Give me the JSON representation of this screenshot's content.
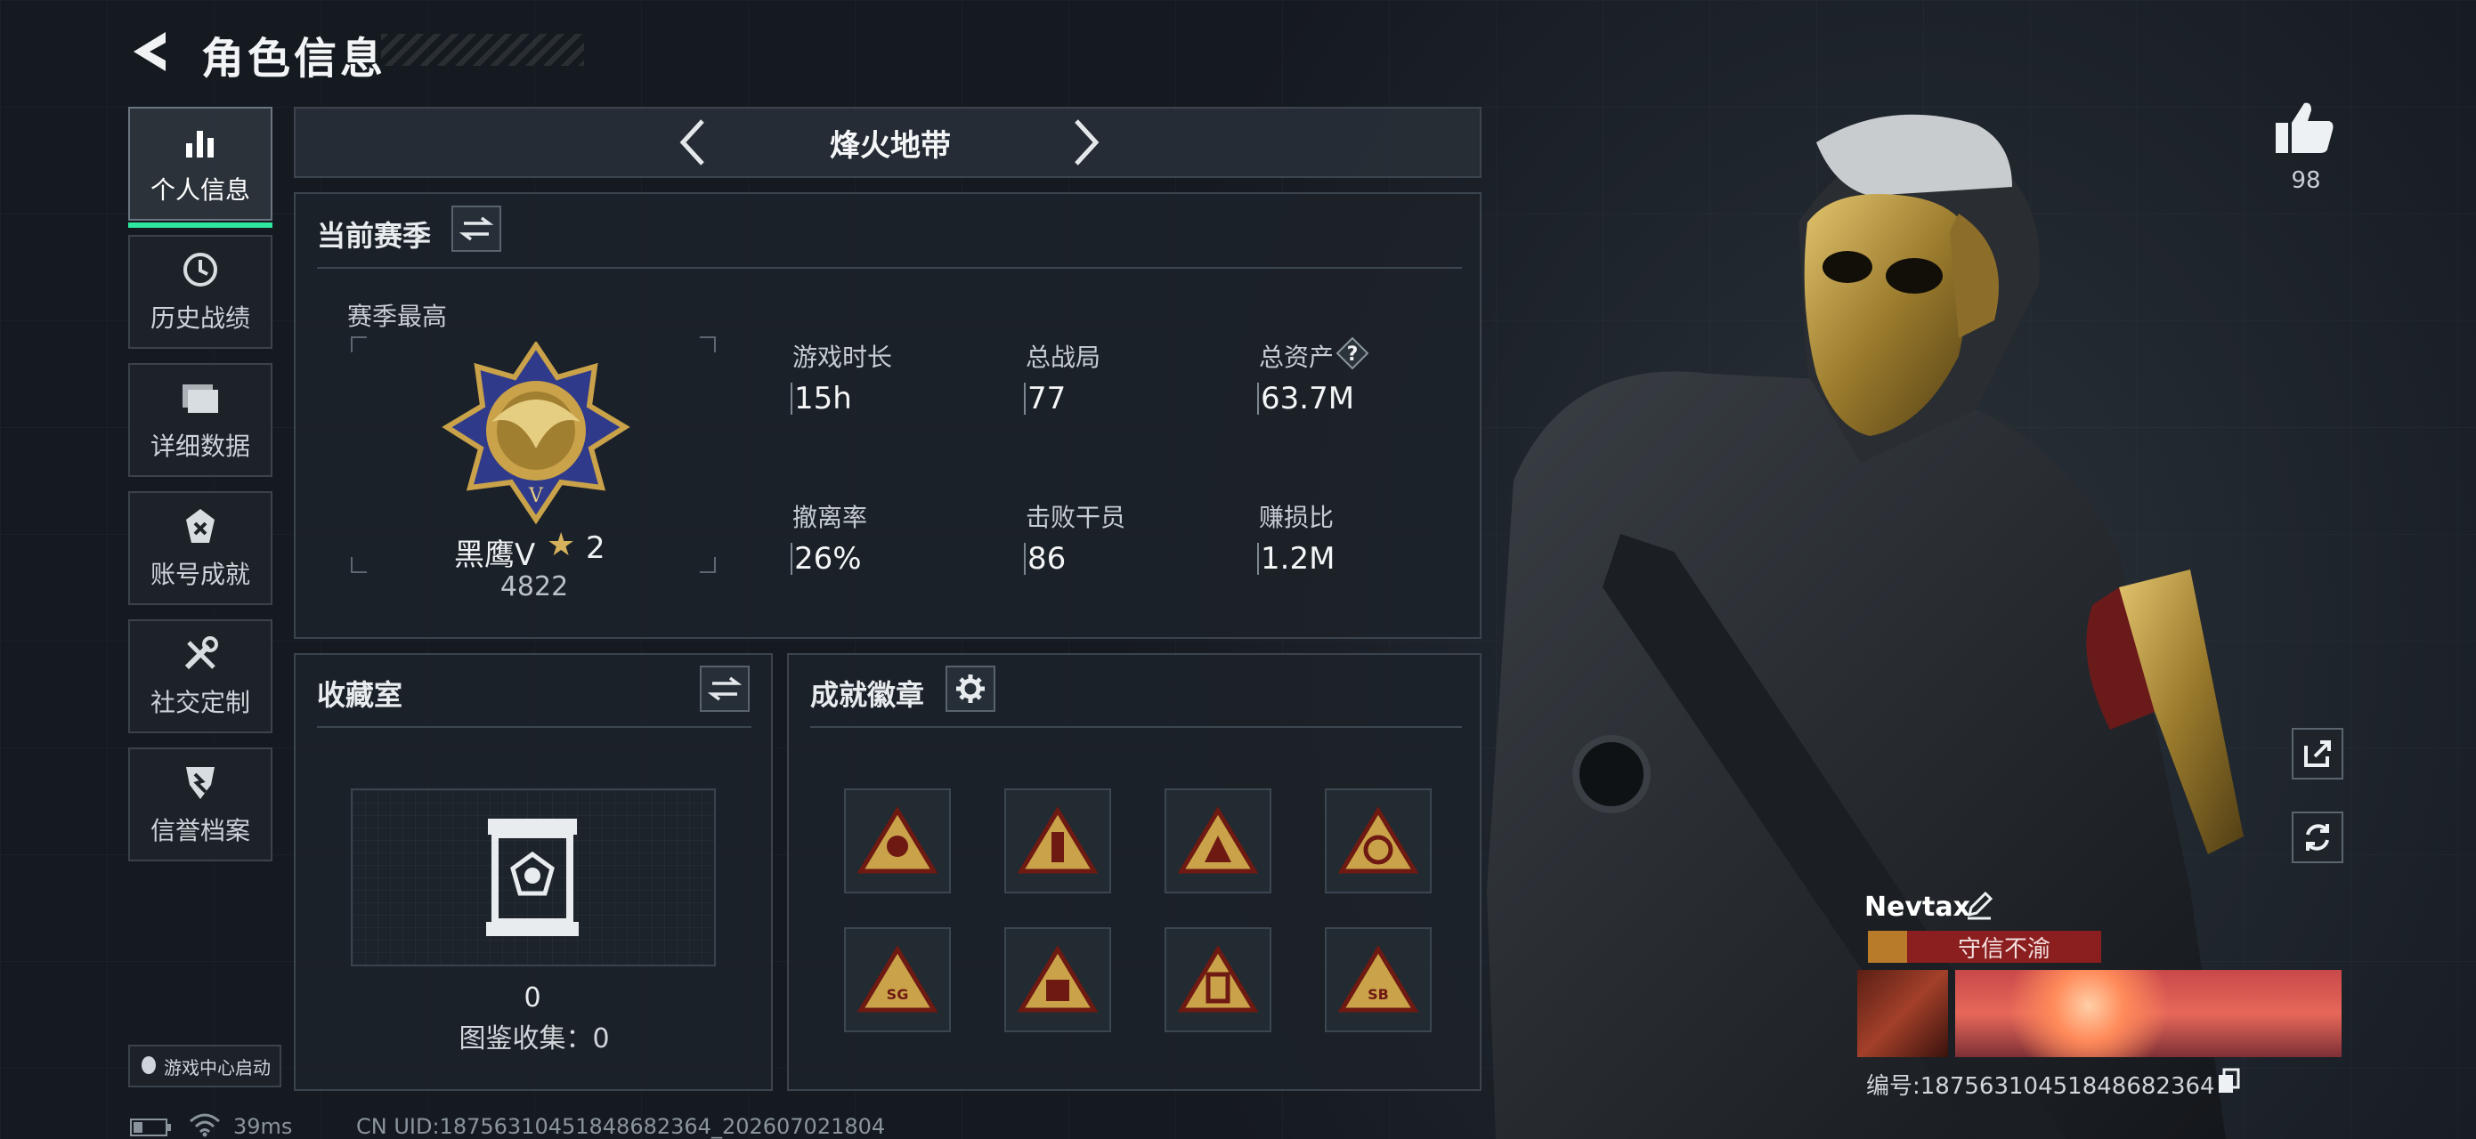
{
  "header": {
    "title": "角色信息"
  },
  "sidebar": {
    "items": [
      {
        "label": "个人信息",
        "icon": "bar-chart-icon",
        "active": true
      },
      {
        "label": "历史战绩",
        "icon": "history-clock-icon"
      },
      {
        "label": "详细数据",
        "icon": "folder-icon"
      },
      {
        "label": "账号成就",
        "icon": "medal-icon"
      },
      {
        "label": "社交定制",
        "icon": "tools-icon"
      },
      {
        "label": "信誉档案",
        "icon": "shield-badge-icon"
      }
    ],
    "launch_label": "游戏中心启动"
  },
  "mode": {
    "name": "烽火地带"
  },
  "season": {
    "title": "当前赛季",
    "best_label": "赛季最高",
    "rank_name": "黑鹰V",
    "rank_stars": "2",
    "rank_score": "4822",
    "stats": [
      {
        "label": "游戏时长",
        "value": "15h"
      },
      {
        "label": "总战局",
        "value": "77"
      },
      {
        "label": "总资产",
        "value": "63.7M"
      },
      {
        "label": "撤离率",
        "value": "26%"
      },
      {
        "label": "击败干员",
        "value": "86"
      },
      {
        "label": "赚损比",
        "value": "1.2M"
      }
    ],
    "help_symbol": "?"
  },
  "collection": {
    "title": "收藏室",
    "count": "0",
    "guide": "图鉴收集：0"
  },
  "badges": {
    "title": "成就徽章",
    "items": [
      {
        "icon": "achievement-badge-1-icon"
      },
      {
        "icon": "achievement-badge-2-icon"
      },
      {
        "icon": "achievement-badge-3-icon"
      },
      {
        "icon": "achievement-badge-4-icon"
      },
      {
        "icon": "achievement-badge-5-icon",
        "text": "SG"
      },
      {
        "icon": "achievement-badge-6-icon"
      },
      {
        "icon": "achievement-badge-7-icon"
      },
      {
        "icon": "achievement-badge-8-icon",
        "text": "SB"
      }
    ]
  },
  "profile": {
    "likes": "98",
    "name": "Nevtax",
    "tag": "守信不渝",
    "id_text": "编号:1875631045184868236​4"
  },
  "status": {
    "ping": "39ms",
    "uid": "CN UID:1875631045184868236​4_202607021804"
  },
  "colors": {
    "accent": "#2ee8a0",
    "gold": "#c9a24a",
    "tag_red": "#8b1f1f"
  }
}
